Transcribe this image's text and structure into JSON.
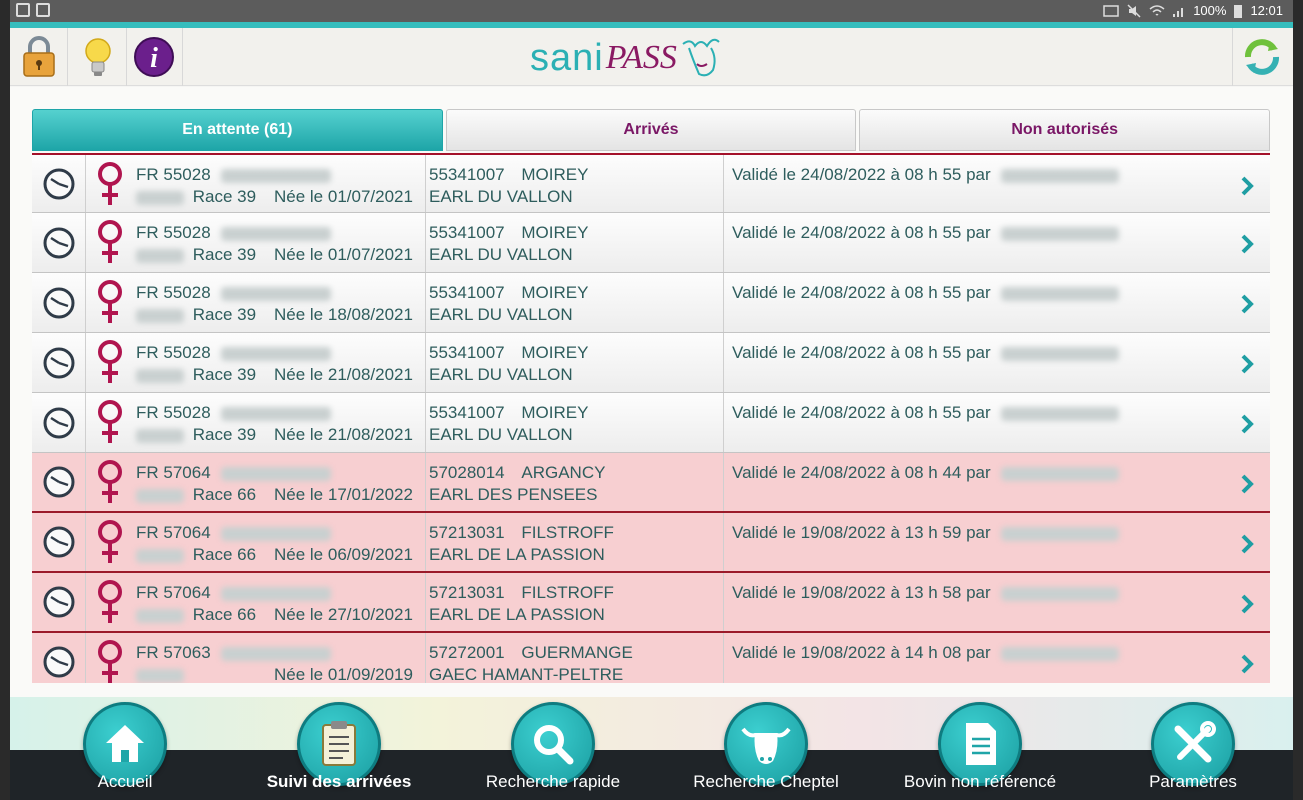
{
  "status_bar": {
    "battery": "100%",
    "time": "12:01"
  },
  "app": {
    "logo_sani": "sani",
    "logo_pass": "PASS"
  },
  "tabs": [
    {
      "label": "En attente (61)",
      "active": true
    },
    {
      "label": "Arrivés",
      "active": false
    },
    {
      "label": "Non autorisés",
      "active": false
    }
  ],
  "rows": [
    {
      "id": "FR 55028",
      "race": "Race 39",
      "born": "Née le 01/07/2021",
      "farm_code": "55341007",
      "farm_town": "MOIREY",
      "farm_name": "EARL DU VALLON",
      "validated": "Validé le 24/08/2022 à 08 h 55 par",
      "alert": false
    },
    {
      "id": "FR 55028",
      "race": "Race 39",
      "born": "Née le 01/07/2021",
      "farm_code": "55341007",
      "farm_town": "MOIREY",
      "farm_name": "EARL DU VALLON",
      "validated": "Validé le 24/08/2022 à 08 h 55 par",
      "alert": false
    },
    {
      "id": "FR 55028",
      "race": "Race 39",
      "born": "Née le 18/08/2021",
      "farm_code": "55341007",
      "farm_town": "MOIREY",
      "farm_name": "EARL DU VALLON",
      "validated": "Validé le 24/08/2022 à 08 h 55 par",
      "alert": false
    },
    {
      "id": "FR 55028",
      "race": "Race 39",
      "born": "Née le 21/08/2021",
      "farm_code": "55341007",
      "farm_town": "MOIREY",
      "farm_name": "EARL DU VALLON",
      "validated": "Validé le 24/08/2022 à 08 h 55 par",
      "alert": false
    },
    {
      "id": "FR 55028",
      "race": "Race 39",
      "born": "Née le 21/08/2021",
      "farm_code": "55341007",
      "farm_town": "MOIREY",
      "farm_name": "EARL DU VALLON",
      "validated": "Validé le 24/08/2022 à 08 h 55 par",
      "alert": false
    },
    {
      "id": "FR 57064",
      "race": "Race 66",
      "born": "Née le 17/01/2022",
      "farm_code": "57028014",
      "farm_town": "ARGANCY",
      "farm_name": "EARL  DES PENSEES",
      "validated": "Validé le 24/08/2022 à 08 h 44 par",
      "alert": true
    },
    {
      "id": "FR 57064",
      "race": "Race 66",
      "born": "Née le 06/09/2021",
      "farm_code": "57213031",
      "farm_town": "FILSTROFF",
      "farm_name": "EARL  DE LA PASSION",
      "validated": "Validé le 19/08/2022 à 13 h 59 par",
      "alert": true
    },
    {
      "id": "FR 57064",
      "race": "Race 66",
      "born": "Née le 27/10/2021",
      "farm_code": "57213031",
      "farm_town": "FILSTROFF",
      "farm_name": "EARL  DE LA PASSION",
      "validated": "Validé le 19/08/2022 à 13 h 58 par",
      "alert": true
    },
    {
      "id": "FR 57063",
      "race": "",
      "born": "Née le 01/09/2019",
      "farm_code": "57272001",
      "farm_town": "GUERMANGE",
      "farm_name": "GAEC  HAMANT-PELTRE",
      "validated": "Validé le 19/08/2022 à 14 h 08 par",
      "alert": true
    }
  ],
  "nav": [
    {
      "label": "Accueil",
      "icon": "home-icon",
      "bold": false
    },
    {
      "label": "Suivi des arrivées",
      "icon": "clipboard-icon",
      "bold": true
    },
    {
      "label": "Recherche rapide",
      "icon": "magnifier-icon",
      "bold": false
    },
    {
      "label": "Recherche Cheptel",
      "icon": "cow-head-icon",
      "bold": false
    },
    {
      "label": "Bovin non référencé",
      "icon": "document-icon",
      "bold": false
    },
    {
      "label": "Paramètres",
      "icon": "tools-icon",
      "bold": false
    }
  ],
  "colors": {
    "teal": "#2bb0b4",
    "purple": "#7a1766",
    "alert_row": "#f7cfd1",
    "text": "#2e5d5d"
  }
}
